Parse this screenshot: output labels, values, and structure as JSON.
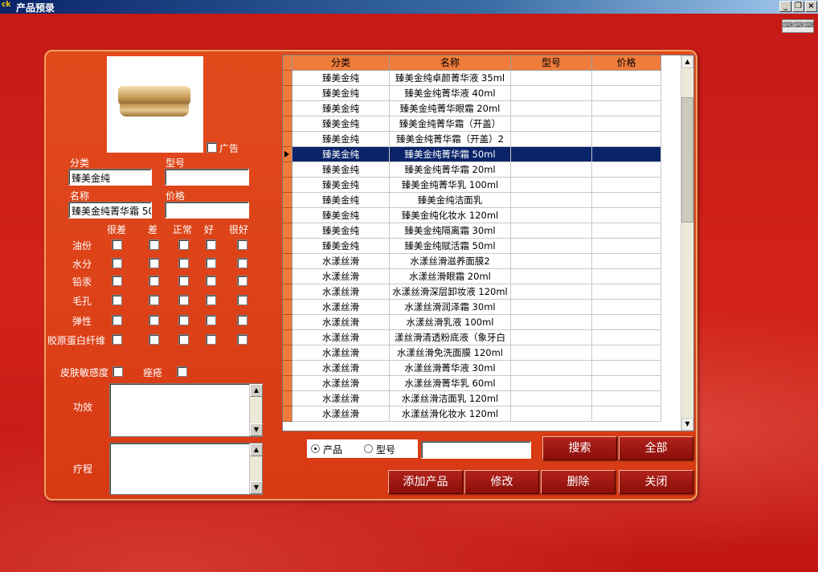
{
  "window": {
    "title": "产品预录",
    "app_icon_text": "ck"
  },
  "form": {
    "ad_label": "广告",
    "category_label": "分类",
    "category_value": "臻美金纯",
    "model_label": "型号",
    "model_value": "",
    "name_label": "名称",
    "name_value": "臻美金纯菁华霜 50",
    "price_label": "价格",
    "price_value": "",
    "rating_headers": [
      "很差",
      "差",
      "正常",
      "好",
      "很好"
    ],
    "skin_rows": [
      "油份",
      "水分",
      "铅汞",
      "毛孔",
      "弹性",
      "胶原蛋白纤维"
    ],
    "sensitivity_label": "皮肤敏感度",
    "acne_label": "痤疮",
    "effect_label": "功效",
    "course_label": "疗程"
  },
  "table": {
    "columns": [
      "分类",
      "名称",
      "型号",
      "价格"
    ],
    "selected_row": 5,
    "rows": [
      {
        "category": "臻美金纯",
        "name": "臻美金纯卓颜菁华液 35ml",
        "model": "",
        "price": ""
      },
      {
        "category": "臻美金纯",
        "name": "臻美金纯菁华液 40ml",
        "model": "",
        "price": ""
      },
      {
        "category": "臻美金纯",
        "name": "臻美金纯菁华眼霜 20ml",
        "model": "",
        "price": ""
      },
      {
        "category": "臻美金纯",
        "name": "臻美金纯菁华霜（开盖）",
        "model": "",
        "price": ""
      },
      {
        "category": "臻美金纯",
        "name": "臻美金纯菁华霜（开盖）2",
        "model": "",
        "price": ""
      },
      {
        "category": "臻美金纯",
        "name": "臻美金纯菁华霜 50ml",
        "model": "",
        "price": ""
      },
      {
        "category": "臻美金纯",
        "name": "臻美金纯菁华霜 20ml",
        "model": "",
        "price": ""
      },
      {
        "category": "臻美金纯",
        "name": "臻美金纯菁华乳 100ml",
        "model": "",
        "price": ""
      },
      {
        "category": "臻美金纯",
        "name": "臻美金纯洁面乳",
        "model": "",
        "price": ""
      },
      {
        "category": "臻美金纯",
        "name": "臻美金纯化妆水 120ml",
        "model": "",
        "price": ""
      },
      {
        "category": "臻美金纯",
        "name": "臻美金纯隔离霜 30ml",
        "model": "",
        "price": ""
      },
      {
        "category": "臻美金纯",
        "name": "臻美金纯赋活霜 50ml",
        "model": "",
        "price": ""
      },
      {
        "category": "水漾丝滑",
        "name": "水漾丝滑滋养面膜2",
        "model": "",
        "price": ""
      },
      {
        "category": "水漾丝滑",
        "name": "水漾丝滑眼霜 20ml",
        "model": "",
        "price": ""
      },
      {
        "category": "水漾丝滑",
        "name": "水漾丝滑深层卸妆液 120ml",
        "model": "",
        "price": ""
      },
      {
        "category": "水漾丝滑",
        "name": "水漾丝滑润泽霜 30ml",
        "model": "",
        "price": ""
      },
      {
        "category": "水漾丝滑",
        "name": "水漾丝滑乳液 100ml",
        "model": "",
        "price": ""
      },
      {
        "category": "水漾丝滑",
        "name": "漾丝滑清透粉底液（象牙白",
        "model": "",
        "price": ""
      },
      {
        "category": "水漾丝滑",
        "name": "水漾丝滑免洗面膜 120ml",
        "model": "",
        "price": ""
      },
      {
        "category": "水漾丝滑",
        "name": "水漾丝滑菁华液 30ml",
        "model": "",
        "price": ""
      },
      {
        "category": "水漾丝滑",
        "name": "水漾丝滑菁华乳 60ml",
        "model": "",
        "price": ""
      },
      {
        "category": "水漾丝滑",
        "name": "水漾丝滑洁面乳 120ml",
        "model": "",
        "price": ""
      },
      {
        "category": "水漾丝滑",
        "name": "水漾丝滑化妆水 120ml",
        "model": "",
        "price": ""
      }
    ]
  },
  "search": {
    "option_product": "产品",
    "option_model": "型号",
    "selected": "产品",
    "query": "",
    "search_label": "搜索",
    "all_label": "全部"
  },
  "actions": {
    "add_label": "添加产品",
    "edit_label": "修改",
    "delete_label": "删除",
    "close_label": "关闭"
  },
  "colors": {
    "header": "#f07c3c",
    "selection": "#0a246a",
    "button": "#8a0e0a"
  }
}
